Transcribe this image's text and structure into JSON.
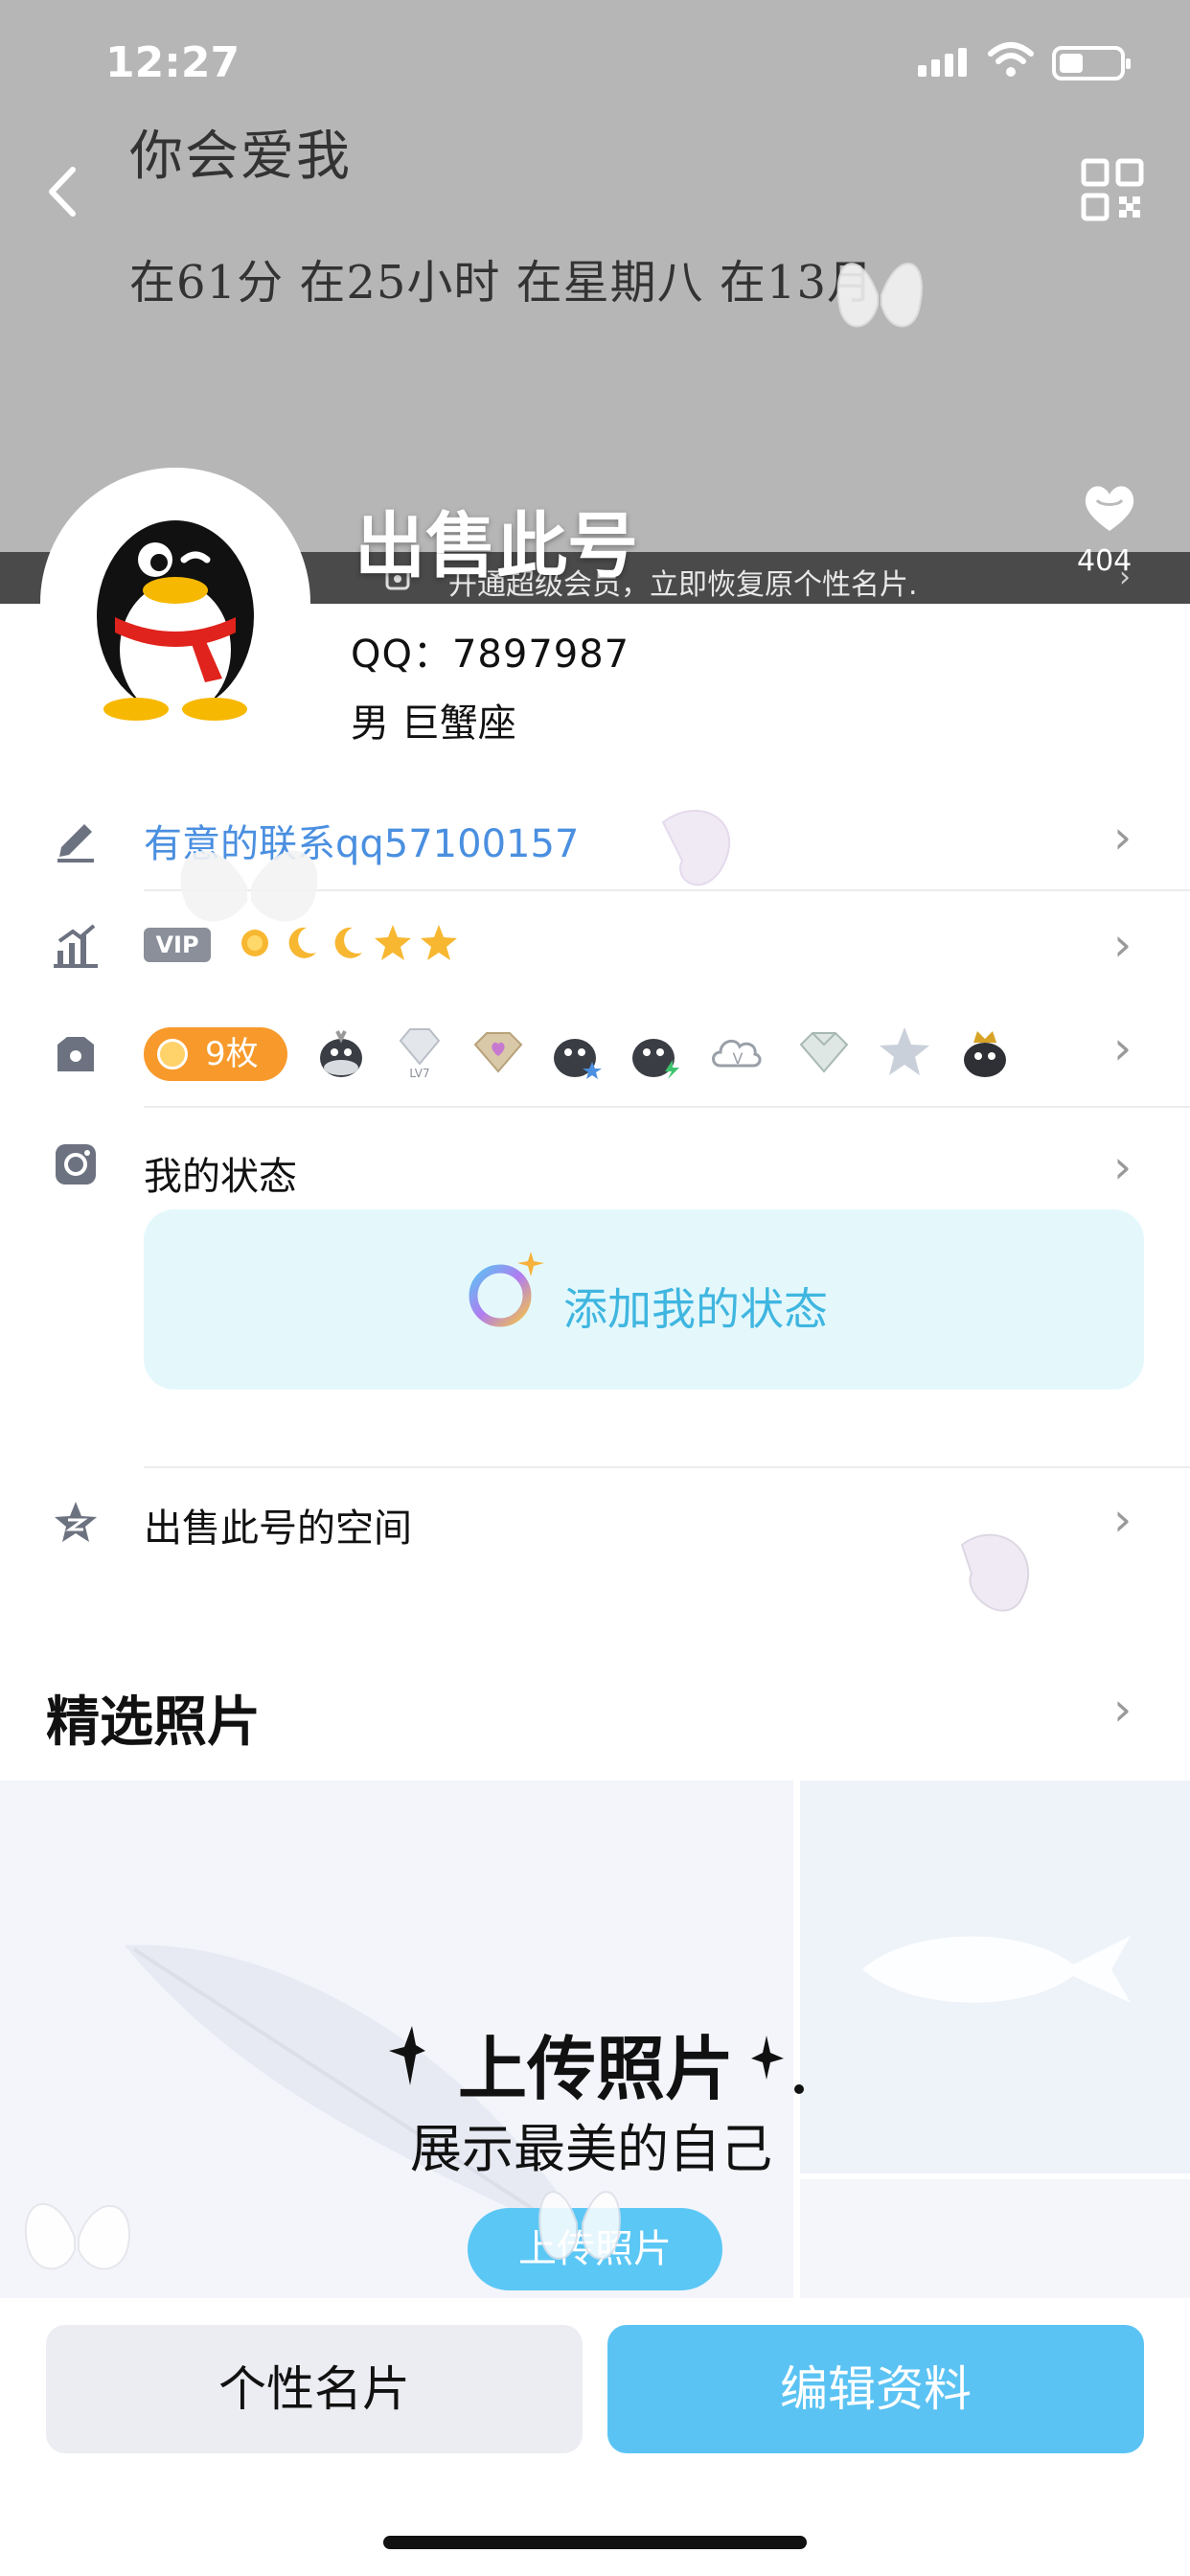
{
  "status_bar": {
    "time": "12:27"
  },
  "cover": {
    "signature_line1": "你会爱我",
    "signature_line2": "在61分 在25小时 在星期八 在13月",
    "vip_banner_text": "开通超级会员，立即恢复原个性名片.",
    "vip_banner_arrow": "›"
  },
  "profile": {
    "nickname": "出售此号",
    "like_count": "404",
    "qq_number": "QQ：7897987",
    "gender_sign": "男  巨蟹座"
  },
  "rows": {
    "sign_text": "有意的联系qq57100157",
    "vip_tag": "VIP",
    "level_icons": [
      "sun-icon",
      "moon-icon",
      "moon-icon",
      "star-icon",
      "star-icon"
    ],
    "medal_count": "9枚",
    "medal_icons": [
      "penguin-medal",
      "diamond-lv7-medal",
      "heart-diamond-medal",
      "penguin-star-medal",
      "penguin-bolt-medal",
      "cloud-v-medal",
      "diamond-medal",
      "star-medal",
      "penguin-crown-medal"
    ],
    "status_label": "我的状态",
    "status_add": "添加我的状态",
    "space_label": "出售此号的空间",
    "chevron": "›"
  },
  "photos": {
    "title": "精选照片",
    "upload_title": "上传照片",
    "upload_subtitle": "展示最美的自己",
    "upload_button": "上传照片"
  },
  "actions": {
    "card_button": "个性名片",
    "edit_button": "编辑资料"
  },
  "colors": {
    "accent": "#5bc3f3",
    "link": "#4a8fe0",
    "medal_badge": "#f79a2b",
    "status_card_bg": "#e4f8fc"
  }
}
